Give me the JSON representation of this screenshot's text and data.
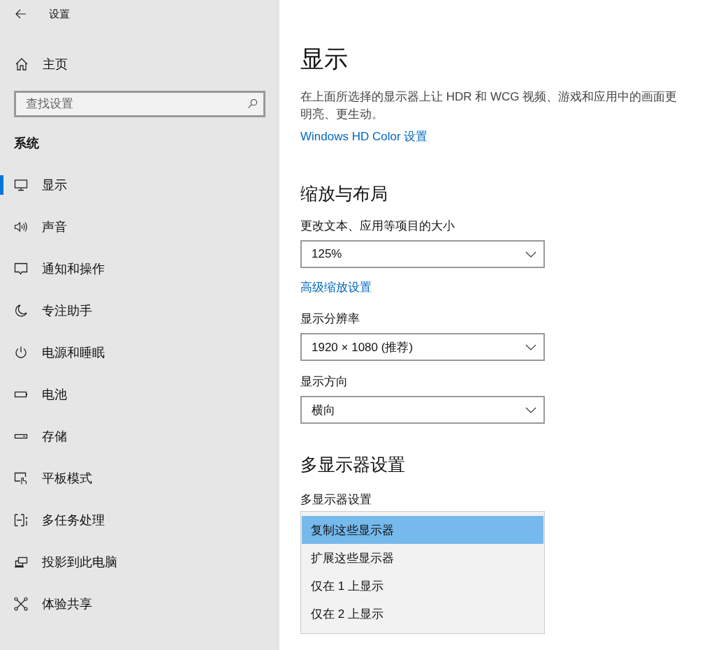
{
  "window": {
    "title": "设置"
  },
  "sidebar": {
    "home": "主页",
    "search": {
      "placeholder": "查找设置"
    },
    "section": "系统",
    "items": [
      {
        "label": "显示",
        "selected": true
      },
      {
        "label": "声音",
        "selected": false
      },
      {
        "label": "通知和操作",
        "selected": false
      },
      {
        "label": "专注助手",
        "selected": false
      },
      {
        "label": "电源和睡眠",
        "selected": false
      },
      {
        "label": "电池",
        "selected": false
      },
      {
        "label": "存储",
        "selected": false
      },
      {
        "label": "平板模式",
        "selected": false
      },
      {
        "label": "多任务处理",
        "selected": false
      },
      {
        "label": "投影到此电脑",
        "selected": false
      },
      {
        "label": "体验共享",
        "selected": false
      }
    ]
  },
  "main": {
    "title": "显示",
    "description": "在上面所选择的显示器上让 HDR 和 WCG 视频、游戏和应用中的画面更明亮、更生动。",
    "hdr_link": "Windows HD Color 设置",
    "scale_heading": "缩放与布局",
    "scale": {
      "label": "更改文本、应用等项目的大小",
      "value": "125%"
    },
    "advanced_link": "高级缩放设置",
    "resolution": {
      "label": "显示分辨率",
      "value": "1920 × 1080 (推荐)"
    },
    "orientation": {
      "label": "显示方向",
      "value": "横向"
    },
    "multi_heading": "多显示器设置",
    "multi": {
      "label": "多显示器设置",
      "expanded": true,
      "options": [
        {
          "label": "复制这些显示器",
          "selected": true
        },
        {
          "label": "扩展这些显示器",
          "selected": false
        },
        {
          "label": "仅在 1 上显示",
          "selected": false
        },
        {
          "label": "仅在 2 上显示",
          "selected": false
        }
      ]
    }
  }
}
